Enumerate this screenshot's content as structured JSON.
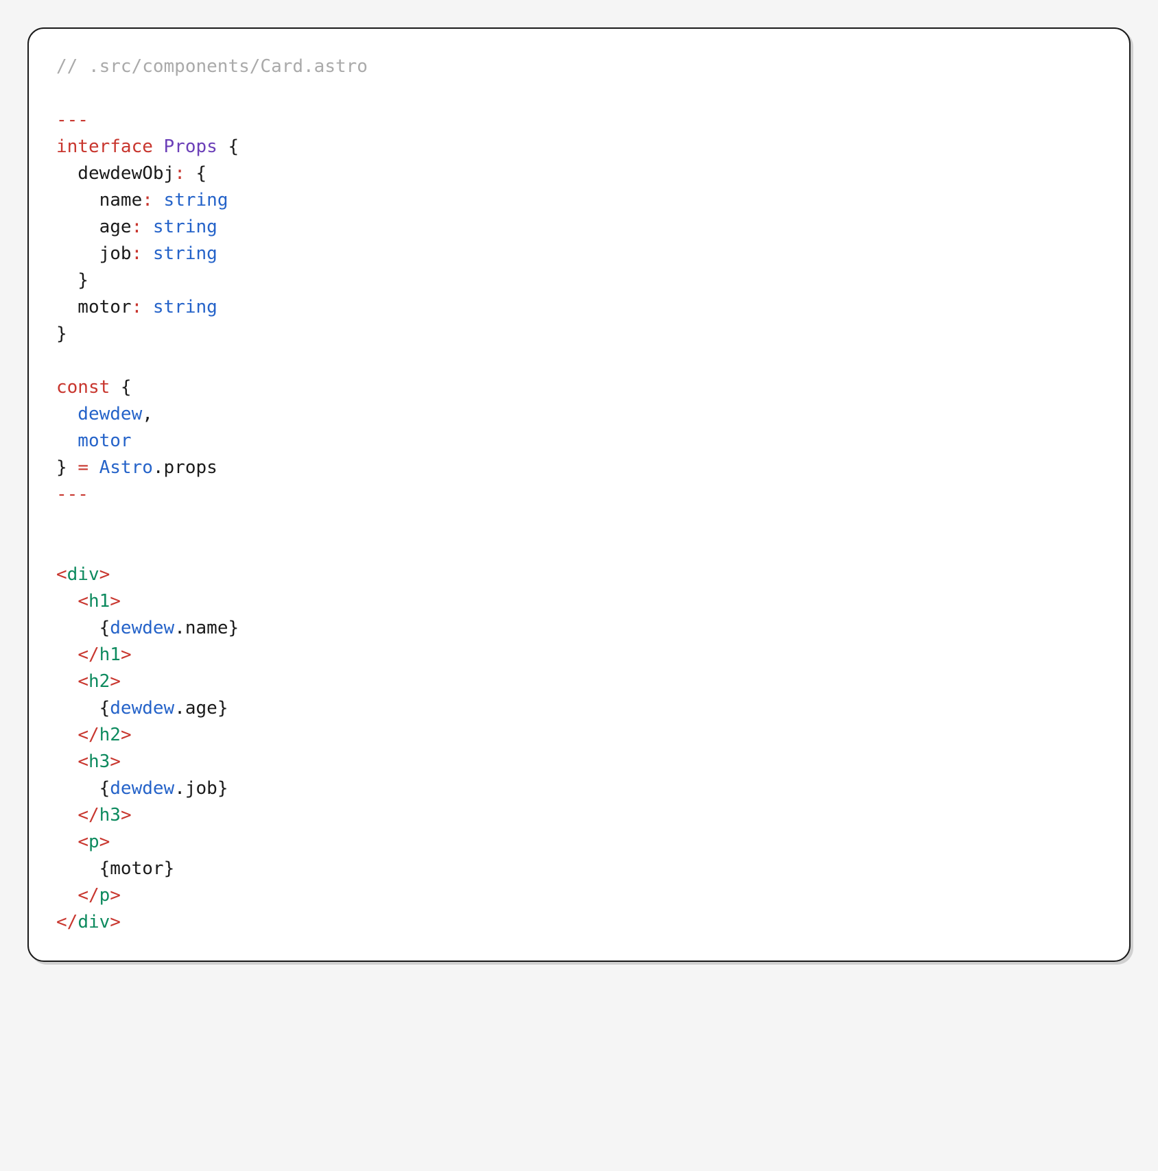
{
  "code": {
    "comment": "// .src/components/Card.astro",
    "fence1": "---",
    "interface_kw": "interface",
    "interface_name": "Props",
    "brace_open": " {",
    "prop1_name": "  dewdewObj",
    "colon": ":",
    "nested_open": " {",
    "nested1_key": "    name",
    "nested1_type": "string",
    "nested2_key": "    age",
    "nested2_type": "string",
    "nested3_key": "    job",
    "nested3_type": "string",
    "nested_close": "  }",
    "prop2_name": "  motor",
    "prop2_type": "string",
    "brace_close": "}",
    "const_kw": "const",
    "destr_open": " {",
    "destr1": "  dewdew",
    "comma": ",",
    "destr2": "  motor",
    "destr_close": "} ",
    "equals": "=",
    "astro": " Astro",
    "dot": ".",
    "props": "props",
    "fence2": "---",
    "lt": "<",
    "gt": ">",
    "slash": "/",
    "tag_div": "div",
    "tag_h1": "h1",
    "tag_h2": "h2",
    "tag_h3": "h3",
    "tag_p": "p",
    "expr_open": "{",
    "expr_close": "}",
    "dewdew_ref": "dewdew",
    "name_prop": "name",
    "age_prop": "age",
    "job_prop": "job",
    "motor_ref": "motor",
    "sp2": "  ",
    "sp4": "    "
  }
}
